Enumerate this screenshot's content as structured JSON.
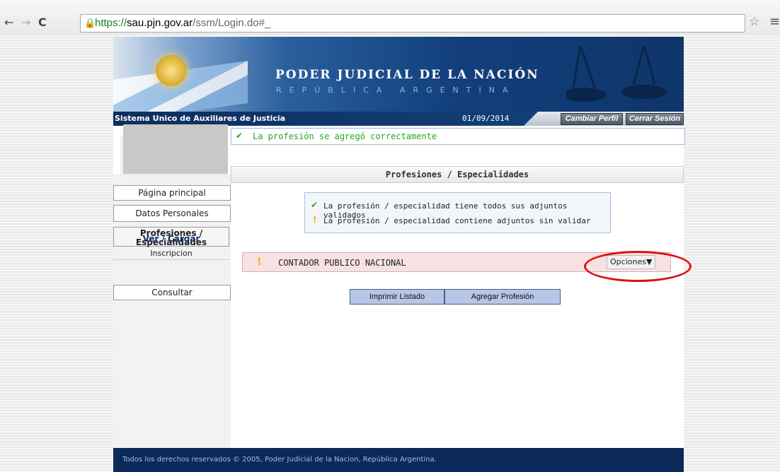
{
  "browser": {
    "back_icon": "←",
    "forward_icon": "→",
    "reload_icon": "C",
    "url_scheme": "https://",
    "url_host": "sau.pjn.gov.ar",
    "url_rest": "/ssm/Login.do#_",
    "star_icon": "☆",
    "menu_icon": "≡"
  },
  "header": {
    "title": "PODER JUDICIAL DE LA NACIÓN",
    "subtitle": "REPÚBLICA ARGENTINA",
    "system_name": "Sistema Unico de Auxiliares de Justicia",
    "date": "01/09/2014",
    "change_profile": "Cambiar Perfil",
    "logout": "Cerrar Sesión"
  },
  "sidebar": {
    "items": [
      {
        "label": "Página principal"
      },
      {
        "label": "Datos Personales"
      },
      {
        "label": "Profesiones / Especialidades"
      },
      {
        "label": "Consultar"
      }
    ],
    "sub_active": "Ver / Cargar",
    "sub_other": "Inscripcion"
  },
  "content": {
    "success_msg": "La profesión se agregó correctamente",
    "section_title": "Profesiones / Especialidades",
    "legend_valid": "La profesión / especialidad tiene todos sus adjuntos validados",
    "legend_pending": "La profesión / especialidad contiene adjuntos sin validar",
    "profession_name": "CONTADOR PUBLICO NACIONAL",
    "options_label": "Opciones▼",
    "print_button": "Imprimir Listado",
    "add_button": "Agregar Profesión"
  },
  "footer": {
    "text": "Todos los derechos reservados © 2005, Poder Judicial de la Nacion, República Argentina."
  }
}
